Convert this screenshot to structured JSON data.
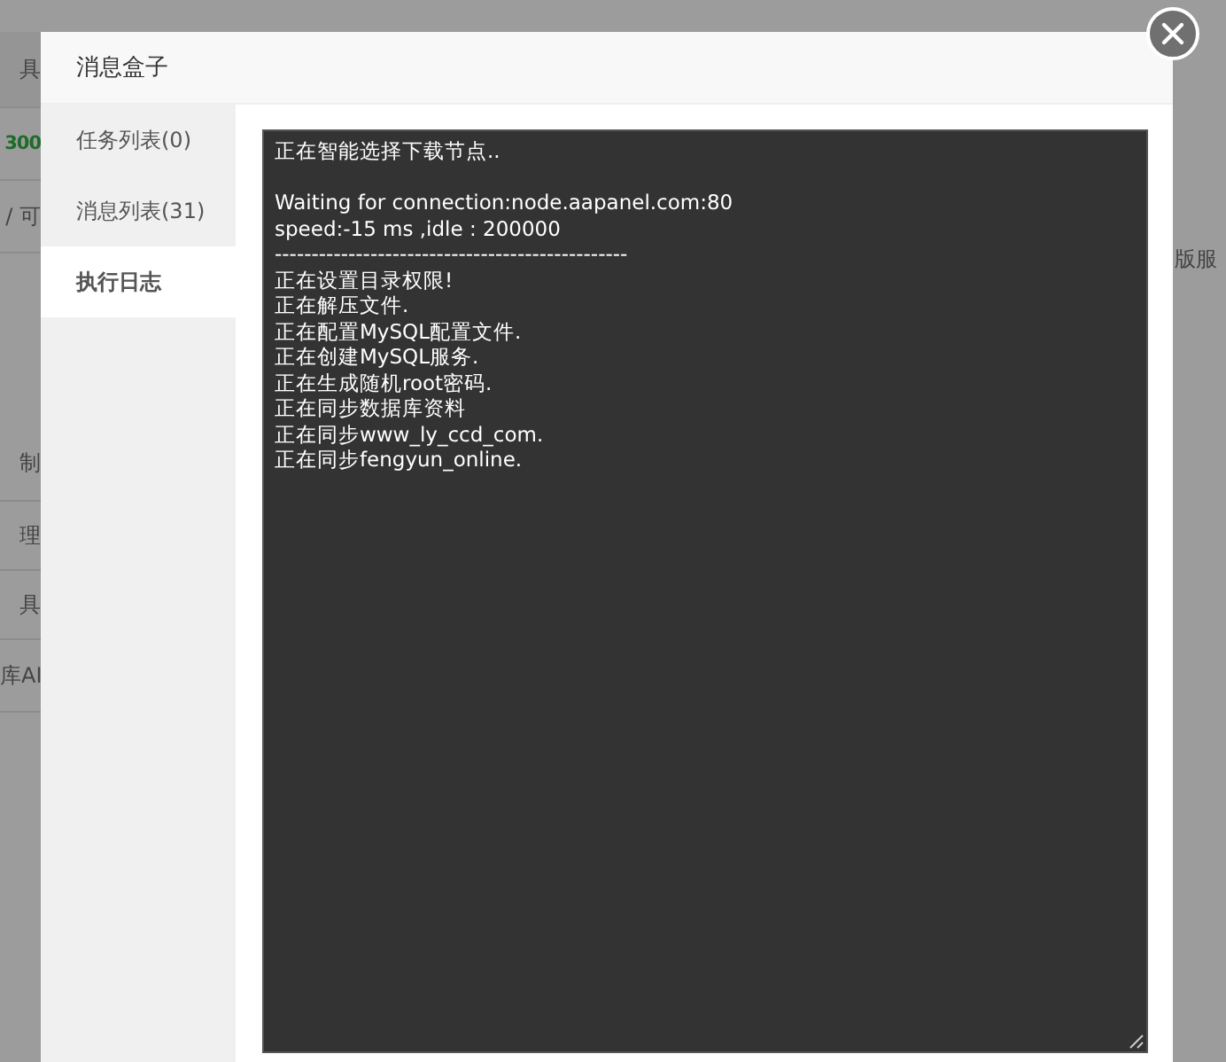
{
  "background": {
    "left_fragments": [
      {
        "text": "具",
        "kind": "plain"
      },
      {
        "text": "300",
        "kind": "green"
      },
      {
        "text": "/ 可",
        "kind": "plain"
      },
      {
        "text": "制",
        "kind": "plain"
      },
      {
        "text": "理",
        "kind": "plain"
      },
      {
        "text": "具",
        "kind": "plain"
      },
      {
        "text": "库AI",
        "kind": "plain"
      }
    ],
    "right_fragments": [
      {
        "text": "版服"
      }
    ]
  },
  "dialog": {
    "title": "消息盒子",
    "tabs": [
      {
        "label": "任务列表(0)",
        "selected": false
      },
      {
        "label": "消息列表(31)",
        "selected": false
      },
      {
        "label": "执行日志",
        "selected": true
      }
    ],
    "log": [
      [
        "正在智能选择下载节点.."
      ],
      [
        "Waiting for connection:node.aapanel.com:80",
        "speed:-15 ms ,idle : 200000",
        "------------------------------------------------",
        "正在设置目录权限!",
        "正在解压文件.",
        "正在配置MySQL配置文件.",
        "正在创建MySQL服务.",
        "正在生成随机root密码.",
        "正在同步数据库资料",
        "正在同步www_ly_ccd_com.",
        "正在同步fengyun_online."
      ]
    ]
  }
}
